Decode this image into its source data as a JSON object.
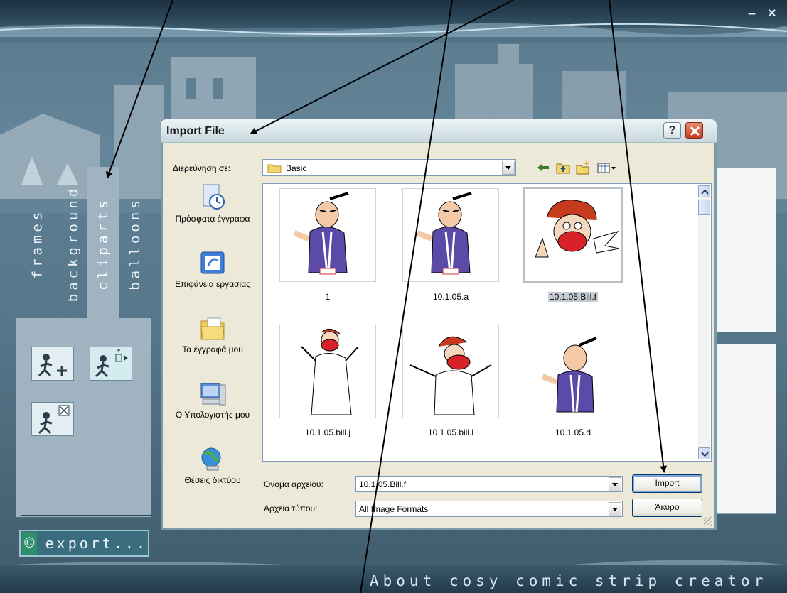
{
  "app": {
    "window_controls": {
      "minimize": "–",
      "close": "×"
    },
    "tabs": [
      {
        "id": "frames",
        "label": "frames"
      },
      {
        "id": "background",
        "label": "background"
      },
      {
        "id": "cliparts",
        "label": "cliparts"
      },
      {
        "id": "balloons",
        "label": "balloons"
      }
    ],
    "tools": [
      {
        "name": "add-clipart",
        "icon": "figure-plus-icon"
      },
      {
        "name": "arrange-clipart",
        "icon": "figure-layers-icon"
      },
      {
        "name": "delete-clipart",
        "icon": "figure-delete-icon"
      }
    ],
    "export": {
      "icon": "©",
      "label": "export..."
    },
    "footer_text": "About cosy comic strip creator"
  },
  "dialog": {
    "title": "Import File",
    "help_label": "?",
    "look_in_label": "Διερεύνηση σε:",
    "look_in_value": "Basic",
    "toolbar_icons": [
      "back-arrow-icon",
      "up-folder-icon",
      "new-folder-icon",
      "view-menu-icon"
    ],
    "places": [
      {
        "label": "Πρόσφατα έγγραφα",
        "icon": "recent-documents-icon"
      },
      {
        "label": "Επιφάνεια εργασίας",
        "icon": "desktop-icon"
      },
      {
        "label": "Τα έγγραφά μου",
        "icon": "my-documents-icon"
      },
      {
        "label": "Ο Υπολογιστής μου",
        "icon": "my-computer-icon"
      },
      {
        "label": "Θέσεις δικτύου",
        "icon": "network-places-icon"
      }
    ],
    "files": [
      {
        "name": "1",
        "character": "samurai"
      },
      {
        "name": "10.1.05.a",
        "character": "samurai"
      },
      {
        "name": "10.1.05.Bill.f",
        "character": "bill-face",
        "selected": true
      },
      {
        "name": "10.1.05.bill.j",
        "character": "bill-white"
      },
      {
        "name": "10.1.05.bill.l",
        "character": "bill-shrug"
      },
      {
        "name": "10.1.05.d",
        "character": "samurai"
      }
    ],
    "filename_label": "Όνομα αρχείου:",
    "filename_value": "10.1.05.Bill.f",
    "filetype_label": "Αρχεία τύπου:",
    "filetype_value": "All Image Formats",
    "import_button": "Import",
    "cancel_button": "Άκυρο"
  }
}
